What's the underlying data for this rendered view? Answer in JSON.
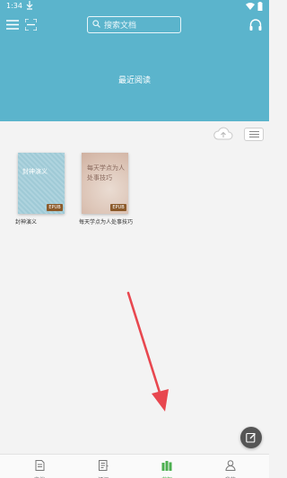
{
  "status": {
    "time": "1:34",
    "download_icon": "download-icon",
    "wifi_icon": "wifi-icon",
    "battery_icon": "battery-icon"
  },
  "header": {
    "bg_color": "#5bb4cc",
    "menu_icon": "hamburger-menu-icon",
    "scan_icon": "scan-icon",
    "search_placeholder": "搜索文档",
    "headset_icon": "headset-icon",
    "recent_label": "最近阅读"
  },
  "shelf": {
    "cloud_icon": "cloud-upload-icon",
    "view_icon": "list-view-icon",
    "books": [
      {
        "title": "封神演义",
        "cover_text": "封神演义",
        "badge": "EPUB"
      },
      {
        "title": "每天学点为人处事技巧",
        "cover_text": "每天学点为人处事技巧",
        "badge": "EPUB"
      }
    ]
  },
  "fab": {
    "icon": "edit-icon"
  },
  "bottom_nav": {
    "accent_color": "#4caf50",
    "items": [
      {
        "label": "文档",
        "icon": "document-icon",
        "active": false
      },
      {
        "label": "订阅",
        "icon": "subscribe-icon",
        "active": false
      },
      {
        "label": "书架",
        "icon": "bookshelf-icon",
        "active": true
      },
      {
        "label": "我的",
        "icon": "profile-icon",
        "active": false
      }
    ]
  }
}
